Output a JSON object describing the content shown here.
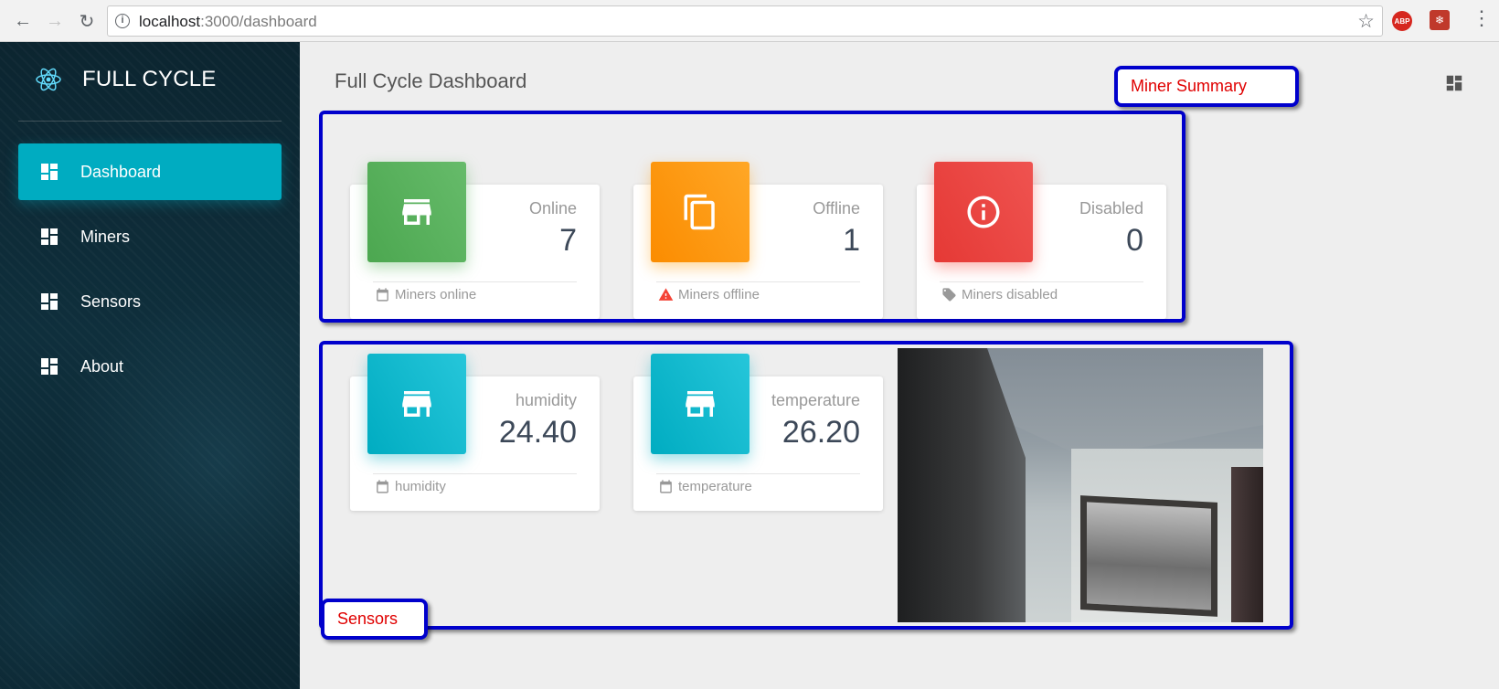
{
  "browser": {
    "url_host": "localhost",
    "url_path": ":3000/dashboard",
    "extensions": [
      "ABP",
      "paw"
    ]
  },
  "sidebar": {
    "brand": "FULL CYCLE",
    "items": [
      {
        "label": "Dashboard",
        "icon": "dashboard-icon",
        "active": true
      },
      {
        "label": "Miners",
        "icon": "dashboard-icon",
        "active": false
      },
      {
        "label": "Sensors",
        "icon": "dashboard-icon",
        "active": false
      },
      {
        "label": "About",
        "icon": "dashboard-icon",
        "active": false
      }
    ]
  },
  "main": {
    "title": "Full Cycle Dashboard",
    "annotations": {
      "miner_summary": "Miner Summary",
      "sensors": "Sensors"
    },
    "miner_cards": [
      {
        "category": "Online",
        "value": "7",
        "footer": "Miners online",
        "color": "#4caf50",
        "icon": "store-icon",
        "footer_icon": "calendar-icon"
      },
      {
        "category": "Offline",
        "value": "1",
        "footer": "Miners offline",
        "color": "#ff9800",
        "icon": "copy-icon",
        "footer_icon": "warning-icon"
      },
      {
        "category": "Disabled",
        "value": "0",
        "footer": "Miners disabled",
        "color": "#f44336",
        "icon": "info-icon",
        "footer_icon": "tag-icon"
      }
    ],
    "sensor_cards": [
      {
        "category": "humidity",
        "value": "24.40",
        "footer": "humidity",
        "color": "#00acc1",
        "icon": "store-icon",
        "footer_icon": "calendar-icon"
      },
      {
        "category": "temperature",
        "value": "26.20",
        "footer": "temperature",
        "color": "#00acc1",
        "icon": "store-icon",
        "footer_icon": "calendar-icon"
      }
    ]
  },
  "colors": {
    "accent": "#00acc1",
    "callout_border": "#0000cc",
    "callout_text": "#e00000"
  }
}
